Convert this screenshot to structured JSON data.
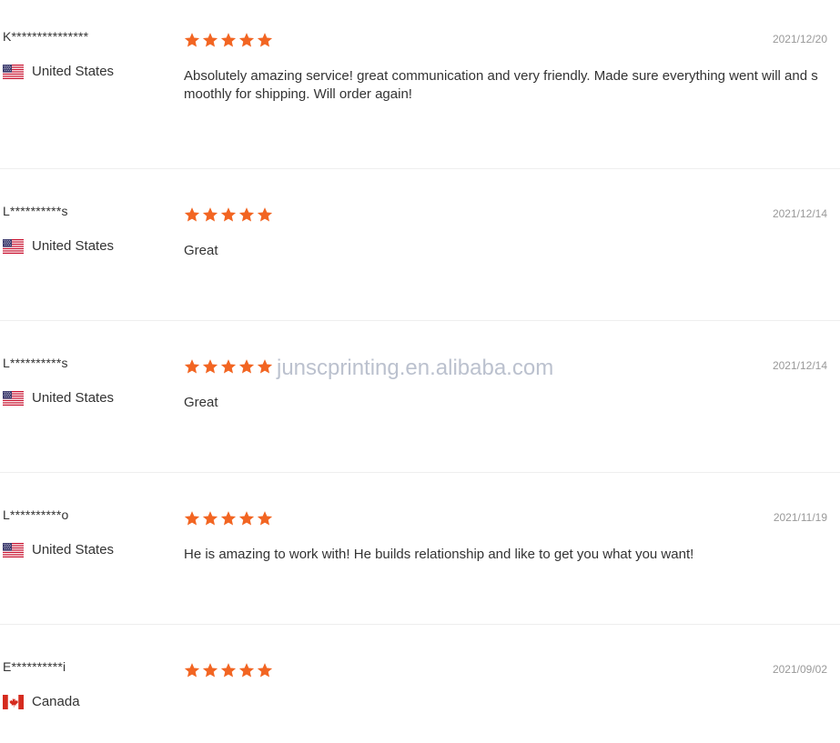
{
  "colors": {
    "star": "#f26522",
    "date": "#999999",
    "text": "#333333",
    "divider": "#eeeeee"
  },
  "watermark": "junscprinting.en.alibaba.com",
  "reviews": [
    {
      "user": "K***************",
      "country": "United States",
      "flag_icon": "us-flag-icon",
      "rating": 5,
      "date": "2021/12/20",
      "comment": "Absolutely amazing service! great communication and very friendly. Made sure everything went will and smoothly for shipping. Will order again!"
    },
    {
      "user": "L**********s",
      "country": "United States",
      "flag_icon": "us-flag-icon",
      "rating": 5,
      "date": "2021/12/14",
      "comment": "Great"
    },
    {
      "user": "L**********s",
      "country": "United States",
      "flag_icon": "us-flag-icon",
      "rating": 5,
      "date": "2021/12/14",
      "comment": "Great"
    },
    {
      "user": "L**********o",
      "country": "United States",
      "flag_icon": "us-flag-icon",
      "rating": 5,
      "date": "2021/11/19",
      "comment": "He is amazing to work with! He builds relationship and like to get you what you want!"
    },
    {
      "user": "E**********i",
      "country": "Canada",
      "flag_icon": "canada-flag-icon",
      "rating": 5,
      "date": "2021/09/02",
      "comment": ""
    }
  ]
}
